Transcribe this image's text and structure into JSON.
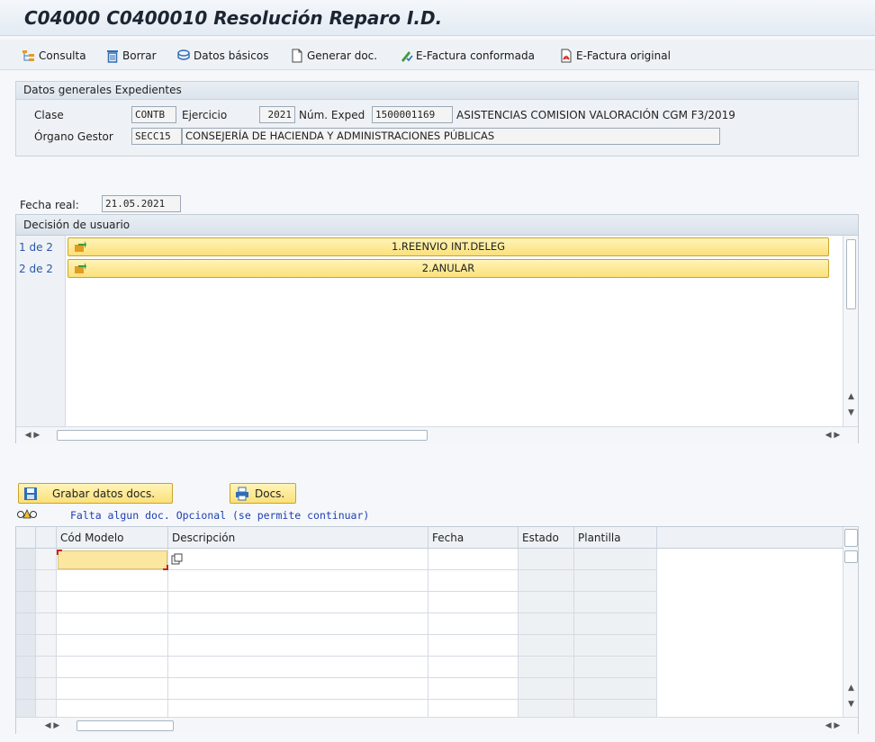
{
  "window": {
    "title": "C04000 C0400010 Resolución Reparo I.D."
  },
  "toolbar": {
    "items": [
      {
        "label": "Consulta",
        "icon": "hierarchy-icon"
      },
      {
        "label": "Borrar",
        "icon": "trash-icon"
      },
      {
        "label": "Datos básicos",
        "icon": "stack-icon"
      },
      {
        "label": "Generar doc.",
        "icon": "document-icon"
      },
      {
        "label": "E-Factura conformada",
        "icon": "pen-check-icon"
      },
      {
        "label": "E-Factura original",
        "icon": "pdf-icon"
      }
    ]
  },
  "general": {
    "header": "Datos generales Expedientes",
    "clase_label": "Clase",
    "clase_value": "CONTB",
    "ejercicio_label": "Ejercicio",
    "ejercicio_value": "2021",
    "num_exped_label": "Núm. Exped",
    "num_exped_value": "1500001169",
    "exped_desc": "ASISTENCIAS COMISION VALORACIÓN CGM F3/2019",
    "organo_label": "Órgano Gestor",
    "organo_value": "SECC15",
    "organo_desc": "CONSEJERÍA DE HACIENDA Y ADMINISTRACIONES PÚBLICAS"
  },
  "fecha": {
    "label": "Fecha real:",
    "value": "21.05.2021"
  },
  "decision": {
    "header": "Decisión de usuario",
    "rows": [
      {
        "index": "1 de 2",
        "label": "1.REENVIO INT.DELEG"
      },
      {
        "index": "2 de 2",
        "label": "2.ANULAR"
      }
    ]
  },
  "actions": {
    "save_label": "Grabar datos docs.",
    "docs_label": "Docs."
  },
  "status": {
    "message": "Falta algun doc. Opcional (se permite continuar)"
  },
  "docs_table": {
    "columns": [
      "Cód Modelo",
      "Descripción",
      "Fecha",
      "Estado",
      "Plantilla"
    ]
  },
  "colors": {
    "accent_yellow": "#fbe07a",
    "title_text": "#1c2632",
    "link_blue": "#2a58a8"
  }
}
